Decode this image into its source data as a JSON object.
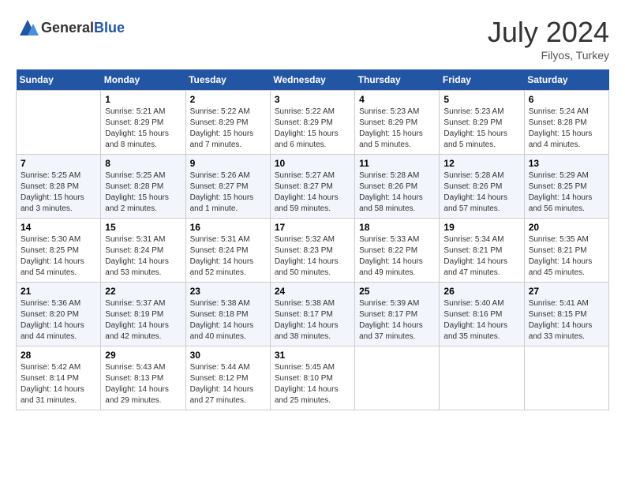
{
  "header": {
    "logo_general": "General",
    "logo_blue": "Blue",
    "month_year": "July 2024",
    "location": "Filyos, Turkey"
  },
  "weekdays": [
    "Sunday",
    "Monday",
    "Tuesday",
    "Wednesday",
    "Thursday",
    "Friday",
    "Saturday"
  ],
  "weeks": [
    [
      {
        "day": "",
        "info": ""
      },
      {
        "day": "1",
        "info": "Sunrise: 5:21 AM\nSunset: 8:29 PM\nDaylight: 15 hours\nand 8 minutes."
      },
      {
        "day": "2",
        "info": "Sunrise: 5:22 AM\nSunset: 8:29 PM\nDaylight: 15 hours\nand 7 minutes."
      },
      {
        "day": "3",
        "info": "Sunrise: 5:22 AM\nSunset: 8:29 PM\nDaylight: 15 hours\nand 6 minutes."
      },
      {
        "day": "4",
        "info": "Sunrise: 5:23 AM\nSunset: 8:29 PM\nDaylight: 15 hours\nand 5 minutes."
      },
      {
        "day": "5",
        "info": "Sunrise: 5:23 AM\nSunset: 8:29 PM\nDaylight: 15 hours\nand 5 minutes."
      },
      {
        "day": "6",
        "info": "Sunrise: 5:24 AM\nSunset: 8:28 PM\nDaylight: 15 hours\nand 4 minutes."
      }
    ],
    [
      {
        "day": "7",
        "info": "Sunrise: 5:25 AM\nSunset: 8:28 PM\nDaylight: 15 hours\nand 3 minutes."
      },
      {
        "day": "8",
        "info": "Sunrise: 5:25 AM\nSunset: 8:28 PM\nDaylight: 15 hours\nand 2 minutes."
      },
      {
        "day": "9",
        "info": "Sunrise: 5:26 AM\nSunset: 8:27 PM\nDaylight: 15 hours\nand 1 minute."
      },
      {
        "day": "10",
        "info": "Sunrise: 5:27 AM\nSunset: 8:27 PM\nDaylight: 14 hours\nand 59 minutes."
      },
      {
        "day": "11",
        "info": "Sunrise: 5:28 AM\nSunset: 8:26 PM\nDaylight: 14 hours\nand 58 minutes."
      },
      {
        "day": "12",
        "info": "Sunrise: 5:28 AM\nSunset: 8:26 PM\nDaylight: 14 hours\nand 57 minutes."
      },
      {
        "day": "13",
        "info": "Sunrise: 5:29 AM\nSunset: 8:25 PM\nDaylight: 14 hours\nand 56 minutes."
      }
    ],
    [
      {
        "day": "14",
        "info": "Sunrise: 5:30 AM\nSunset: 8:25 PM\nDaylight: 14 hours\nand 54 minutes."
      },
      {
        "day": "15",
        "info": "Sunrise: 5:31 AM\nSunset: 8:24 PM\nDaylight: 14 hours\nand 53 minutes."
      },
      {
        "day": "16",
        "info": "Sunrise: 5:31 AM\nSunset: 8:24 PM\nDaylight: 14 hours\nand 52 minutes."
      },
      {
        "day": "17",
        "info": "Sunrise: 5:32 AM\nSunset: 8:23 PM\nDaylight: 14 hours\nand 50 minutes."
      },
      {
        "day": "18",
        "info": "Sunrise: 5:33 AM\nSunset: 8:22 PM\nDaylight: 14 hours\nand 49 minutes."
      },
      {
        "day": "19",
        "info": "Sunrise: 5:34 AM\nSunset: 8:21 PM\nDaylight: 14 hours\nand 47 minutes."
      },
      {
        "day": "20",
        "info": "Sunrise: 5:35 AM\nSunset: 8:21 PM\nDaylight: 14 hours\nand 45 minutes."
      }
    ],
    [
      {
        "day": "21",
        "info": "Sunrise: 5:36 AM\nSunset: 8:20 PM\nDaylight: 14 hours\nand 44 minutes."
      },
      {
        "day": "22",
        "info": "Sunrise: 5:37 AM\nSunset: 8:19 PM\nDaylight: 14 hours\nand 42 minutes."
      },
      {
        "day": "23",
        "info": "Sunrise: 5:38 AM\nSunset: 8:18 PM\nDaylight: 14 hours\nand 40 minutes."
      },
      {
        "day": "24",
        "info": "Sunrise: 5:38 AM\nSunset: 8:17 PM\nDaylight: 14 hours\nand 38 minutes."
      },
      {
        "day": "25",
        "info": "Sunrise: 5:39 AM\nSunset: 8:17 PM\nDaylight: 14 hours\nand 37 minutes."
      },
      {
        "day": "26",
        "info": "Sunrise: 5:40 AM\nSunset: 8:16 PM\nDaylight: 14 hours\nand 35 minutes."
      },
      {
        "day": "27",
        "info": "Sunrise: 5:41 AM\nSunset: 8:15 PM\nDaylight: 14 hours\nand 33 minutes."
      }
    ],
    [
      {
        "day": "28",
        "info": "Sunrise: 5:42 AM\nSunset: 8:14 PM\nDaylight: 14 hours\nand 31 minutes."
      },
      {
        "day": "29",
        "info": "Sunrise: 5:43 AM\nSunset: 8:13 PM\nDaylight: 14 hours\nand 29 minutes."
      },
      {
        "day": "30",
        "info": "Sunrise: 5:44 AM\nSunset: 8:12 PM\nDaylight: 14 hours\nand 27 minutes."
      },
      {
        "day": "31",
        "info": "Sunrise: 5:45 AM\nSunset: 8:10 PM\nDaylight: 14 hours\nand 25 minutes."
      },
      {
        "day": "",
        "info": ""
      },
      {
        "day": "",
        "info": ""
      },
      {
        "day": "",
        "info": ""
      }
    ]
  ]
}
